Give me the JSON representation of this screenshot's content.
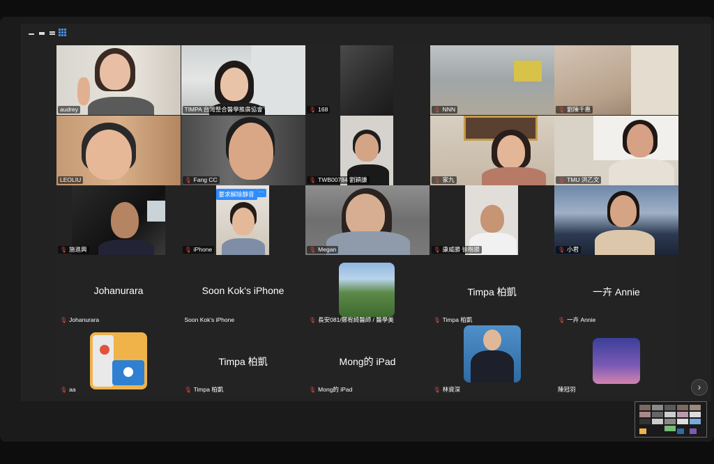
{
  "window": {
    "title": ""
  },
  "toolbar": {
    "icons": [
      "minimize-icon",
      "restore-icon",
      "maximize-icon",
      "gallery-view-icon"
    ]
  },
  "tiles": [
    {
      "name": "audrey",
      "muted": false
    },
    {
      "name": "TIMPA 台灣整合醫學推廣協會",
      "muted": false,
      "active": true
    },
    {
      "name": "168",
      "muted": true
    },
    {
      "name": "NNN",
      "muted": true
    },
    {
      "name": "劉陳千惠",
      "muted": true
    },
    {
      "name": "LEOLIU",
      "muted": false
    },
    {
      "name": "Fang CC",
      "muted": true
    },
    {
      "name": "TWB00784 劉穎謙",
      "muted": true
    },
    {
      "name": "家九",
      "muted": true
    },
    {
      "name": "TMU 洪乙文",
      "muted": true
    },
    {
      "name": "施進興",
      "muted": true
    },
    {
      "name": "iPhone",
      "muted": true
    },
    {
      "name": "Megan",
      "muted": true
    },
    {
      "name": "康威勝 徐楷勝",
      "muted": true
    },
    {
      "name": "小君",
      "muted": true
    },
    {
      "name": "Johanurara",
      "muted": true,
      "display": "Johanurara"
    },
    {
      "name": "Soon Kok's iPhone",
      "muted": false,
      "display": "Soon Kok's iPhone"
    },
    {
      "name": "長安081/鄭宥綺醫師 / 醫學美",
      "muted": true
    },
    {
      "name": "Timpa 柏凱",
      "muted": true,
      "display": "Timpa 柏凱"
    },
    {
      "name": "一卉 Annie",
      "muted": true,
      "display": "一卉 Annie"
    },
    {
      "name": "aa",
      "muted": true
    },
    {
      "name": "Timpa 柏凱",
      "muted": true,
      "display": "Timpa 柏凱"
    },
    {
      "name": "Mong的 iPad",
      "muted": true,
      "display": "Mong的 iPad"
    },
    {
      "name": "林資深",
      "muted": true
    },
    {
      "name": "陳冠羽",
      "muted": false
    }
  ],
  "iphone_tile": {
    "unmute_label": "要求解除靜音",
    "more_label": "···"
  },
  "nav": {
    "next_label": "›"
  },
  "colors": {
    "accent": "#2d8cff",
    "active_border": "#2fbf4f",
    "muted_icon": "#e5483b"
  }
}
